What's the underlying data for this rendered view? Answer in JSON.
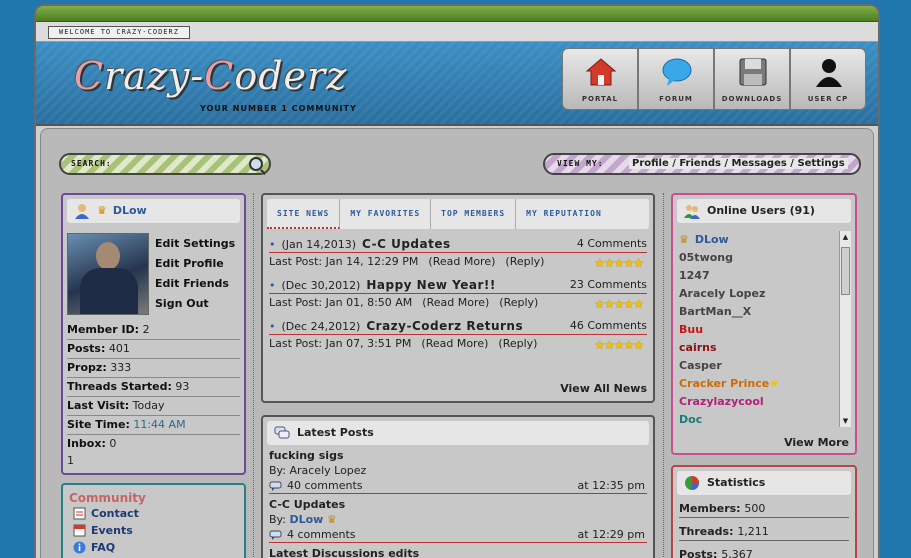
{
  "header": {
    "welcome": "WELCOME TO CRAZY-CODERZ",
    "logo_c1": "C",
    "logo_w1": "razy-",
    "logo_c2": "C",
    "logo_w2": "oderz",
    "tagline": "YOUR NUMBER 1 COMMUNITY",
    "nav": [
      "PORTAL",
      "FORUM",
      "DOWNLOADS",
      "USER CP"
    ]
  },
  "search": {
    "label": "SEARCH:"
  },
  "viewmy": {
    "label": "VIEW MY:",
    "links": "Profile / Friends / Messages / Settings"
  },
  "user": {
    "name": "DLow",
    "links": [
      "Edit Settings",
      "Edit Profile",
      "Edit Friends",
      "Sign Out"
    ],
    "stats": [
      {
        "label": "Member ID:",
        "value": "2"
      },
      {
        "label": "Posts:",
        "value": "401"
      },
      {
        "label": "Propz:",
        "value": "333"
      },
      {
        "label": "Threads Started:",
        "value": "93"
      },
      {
        "label": "Last Visit:",
        "value": "Today"
      },
      {
        "label": "Site Time:",
        "value": "11:44 AM"
      },
      {
        "label": "Inbox:",
        "value": "0"
      }
    ],
    "extra": "1"
  },
  "community": {
    "title": "Community",
    "items": [
      "Contact",
      "Events",
      "FAQ"
    ]
  },
  "news": {
    "tabs": [
      "SITE NEWS",
      "MY FAVORITES",
      "TOP MEMBERS",
      "MY REPUTATION"
    ],
    "items": [
      {
        "date": "(Jan 14,2013)",
        "title": "C-C Updates",
        "comments": "4 Comments",
        "last": "Last Post: Jan 14, 12:29 PM",
        "read": "(Read More)",
        "reply": "(Reply)"
      },
      {
        "date": "(Dec 30,2012)",
        "title": "Happy New Year!!",
        "comments": "23 Comments",
        "last": "Last Post: Jan 01, 8:50 AM",
        "read": "(Read More)",
        "reply": "(Reply)"
      },
      {
        "date": "(Dec 24,2012)",
        "title": "Crazy-Coderz Returns",
        "comments": "46 Comments",
        "last": "Last Post: Jan 07, 3:51 PM",
        "read": "(Read More)",
        "reply": "(Reply)"
      }
    ],
    "view_all": "View All News"
  },
  "latest": {
    "title": "Latest Posts",
    "posts": [
      {
        "title": "fucking sigs",
        "by": "By:",
        "author": "Aracely Lopez",
        "comments": "40 comments",
        "at": "at 12:35 pm"
      },
      {
        "title": "C-C Updates",
        "by": "By:",
        "author": "DLow",
        "comments": "4 comments",
        "at": "at 12:29 pm"
      }
    ],
    "partial": "Latest Discussions edits"
  },
  "online": {
    "title": "Online Users (91)",
    "users": [
      {
        "name": "DLow",
        "color": "#2c5a9a"
      },
      {
        "name": "05twong",
        "color": "#444444"
      },
      {
        "name": "1247",
        "color": "#444444"
      },
      {
        "name": "Aracely Lopez",
        "color": "#444444"
      },
      {
        "name": "BartMan__X",
        "color": "#444444"
      },
      {
        "name": "Buu",
        "color": "#cc1111"
      },
      {
        "name": "cairns",
        "color": "#8a1111"
      },
      {
        "name": "Casper",
        "color": "#444444"
      },
      {
        "name": "Cracker Prince",
        "color": "#d06a00"
      },
      {
        "name": "Crazylazycool",
        "color": "#b0227a"
      },
      {
        "name": "Doc",
        "color": "#1a7a7a"
      }
    ],
    "view_more": "View More"
  },
  "statistics": {
    "title": "Statistics",
    "rows": [
      {
        "label": "Members:",
        "value": "500"
      },
      {
        "label": "Threads:",
        "value": "1,211"
      },
      {
        "label": "Posts:",
        "value": "5,367"
      }
    ]
  },
  "stars": "★★★★★"
}
